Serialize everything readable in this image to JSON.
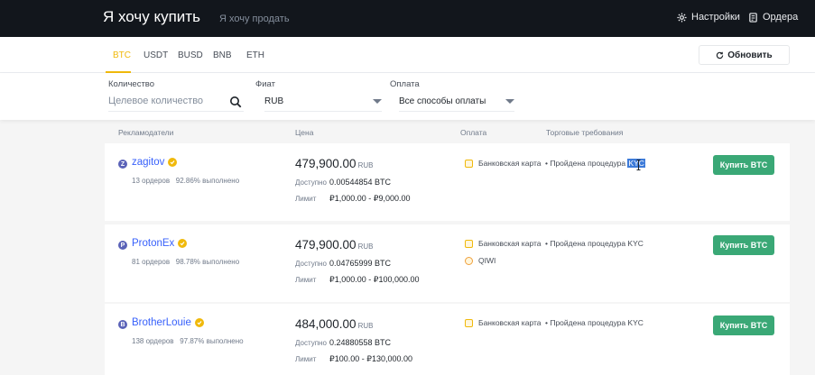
{
  "header": {
    "buy_title": "Я хочу купить",
    "sell_title": "Я хочу продать",
    "settings_label": "Настройки",
    "orders_label": "Ордера"
  },
  "coin_tabs": [
    "BTC",
    "USDT",
    "BUSD",
    "BNB",
    "ETH"
  ],
  "active_coin": "BTC",
  "refresh_label": "Обновить",
  "filters": {
    "amount_label": "Количество",
    "amount_placeholder": "Целевое количество",
    "fiat_label": "Фиат",
    "fiat_value": "RUB",
    "payment_label": "Оплата",
    "payment_value": "Все способы оплаты"
  },
  "columns": {
    "advertisers": "Рекламодатели",
    "price": "Цена",
    "payment": "Оплата",
    "requirements": "Торговые требования"
  },
  "offers": [
    {
      "avatar_letter": "Z",
      "name": "zagitov",
      "orders": "13 ордеров",
      "completion": "92.86% выполнено",
      "price": "479,900.00",
      "currency": "RUB",
      "available_label": "Доступно",
      "available": "0.00544854 BTC",
      "limit_label": "Лимит",
      "limit": "₽1,000.00 - ₽9,000.00",
      "payments": [
        "Банковская карта"
      ],
      "requirement_prefix": "• Пройдена процедура ",
      "requirement_kyc": "KYC",
      "buy_label": "Купить BTC"
    },
    {
      "avatar_letter": "P",
      "name": "ProtonEx",
      "orders": "81 ордеров",
      "completion": "98.78% выполнено",
      "price": "479,900.00",
      "currency": "RUB",
      "available_label": "Доступно",
      "available": "0.04765999 BTC",
      "limit_label": "Лимит",
      "limit": "₽1,000.00 - ₽100,000.00",
      "payments": [
        "Банковская карта",
        "QIWI"
      ],
      "requirement_prefix": "• Пройдена процедура ",
      "requirement_kyc": "KYC",
      "buy_label": "Купить BTC"
    },
    {
      "avatar_letter": "B",
      "name": "BrotherLouie",
      "orders": "138 ордеров",
      "completion": "97.87% выполнено",
      "price": "484,000.00",
      "currency": "RUB",
      "available_label": "Доступно",
      "available": "0.24880558 BTC",
      "limit_label": "Лимит",
      "limit": "₽100.00 - ₽130,000.00",
      "payments": [
        "Банковская карта"
      ],
      "requirement_prefix": "• Пройдена процедура ",
      "requirement_kyc": "KYC",
      "buy_label": "Купить BTC"
    }
  ],
  "colors": {
    "accent": "#f0b90b",
    "buy": "#3aa876",
    "header_bg": "#12161c",
    "link": "#3861fb"
  }
}
